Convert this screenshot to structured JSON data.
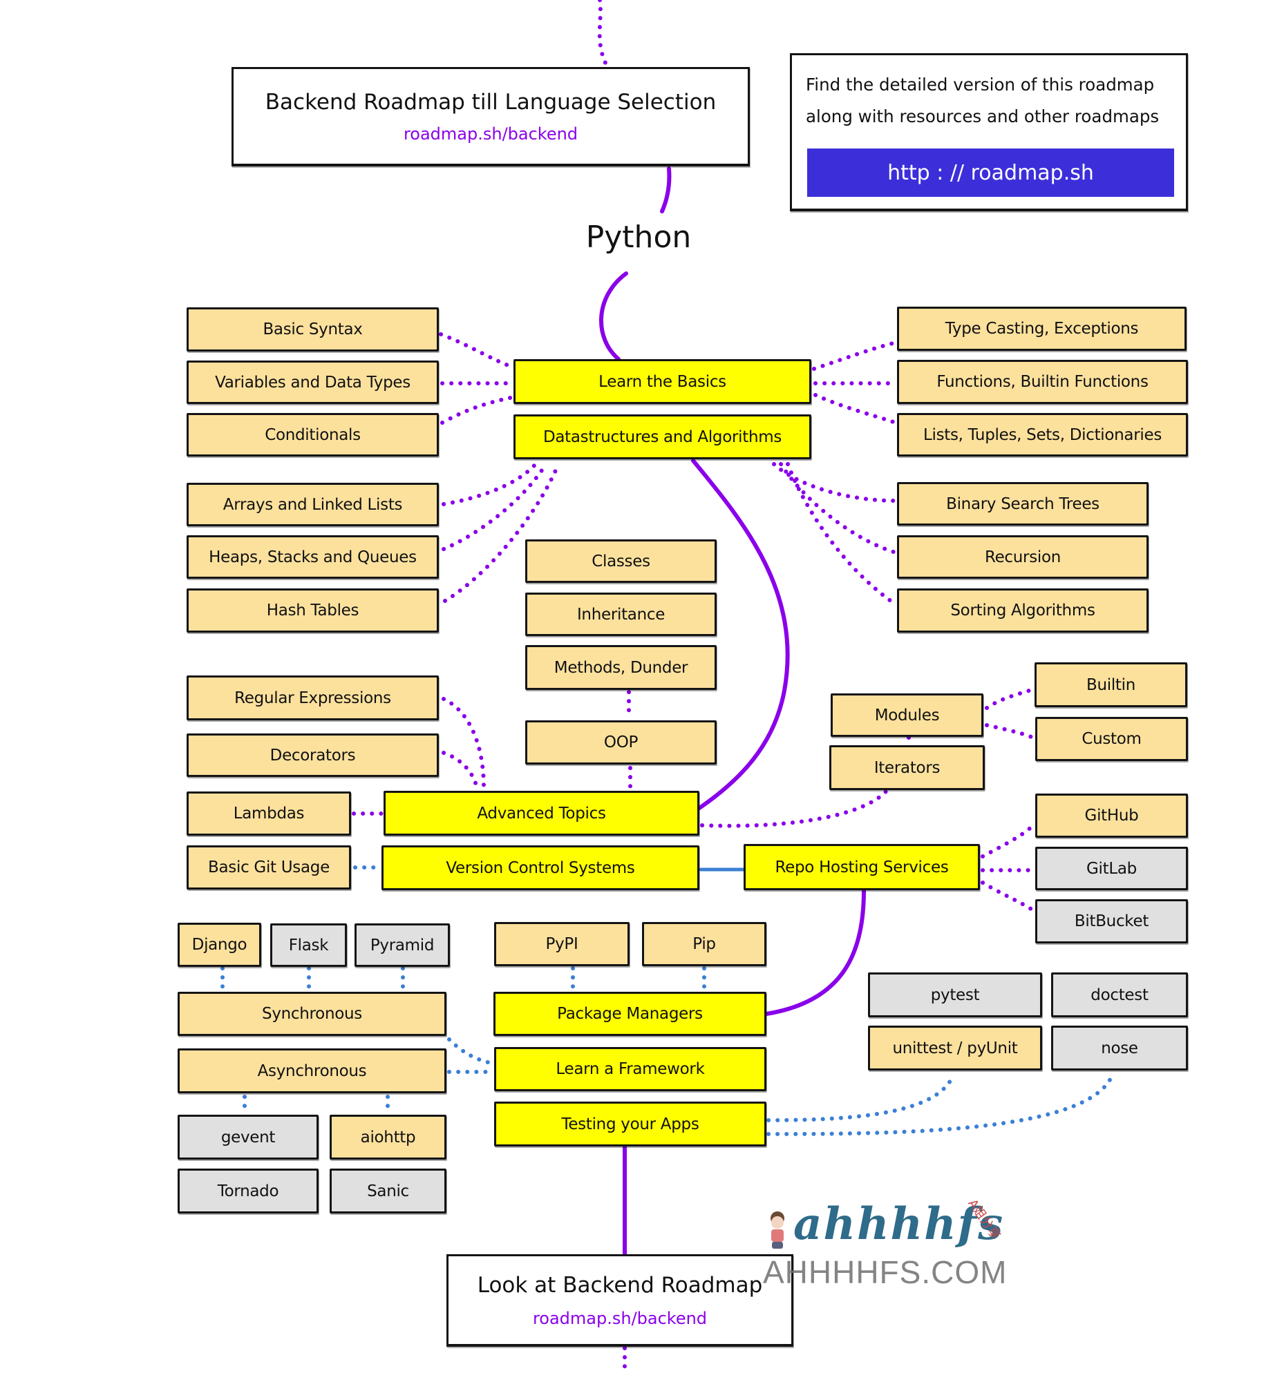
{
  "colors": {
    "main_node": "#ffff00",
    "sub_node": "#fce19d",
    "alt_node": "#e0e0e0",
    "purple_line": "#8a00ea",
    "blue_line": "#3b7fd6",
    "link_text": "#8a00ea",
    "info_button_bg": "#3c2fd9"
  },
  "header": {
    "title": "Backend Roadmap till Language Selection",
    "link": "roadmap.sh/backend"
  },
  "info_card": {
    "line1": "Find the detailed version of this roadmap",
    "line2": "along with resources and other roadmaps",
    "button_label": "http : // roadmap.sh"
  },
  "language": "Python",
  "nodes": {
    "learn_basics": "Learn the Basics",
    "basic_syntax": "Basic Syntax",
    "variables": "Variables and Data Types",
    "conditionals": "Conditionals",
    "type_casting": "Type Casting, Exceptions",
    "functions": "Functions, Builtin Functions",
    "lists": "Lists, Tuples, Sets, Dictionaries",
    "dsa": "Datastructures and Algorithms",
    "arrays": "Arrays and Linked Lists",
    "heaps": "Heaps, Stacks and Queues",
    "hash_tables": "Hash Tables",
    "bst": "Binary Search Trees",
    "recursion": "Recursion",
    "sorting": "Sorting Algorithms",
    "classes": "Classes",
    "inheritance": "Inheritance",
    "methods": "Methods, Dunder",
    "oop": "OOP",
    "regex": "Regular Expressions",
    "decorators": "Decorators",
    "lambdas": "Lambdas",
    "advanced": "Advanced Topics",
    "modules": "Modules",
    "iterators": "Iterators",
    "builtin": "Builtin",
    "custom": "Custom",
    "basic_git": "Basic Git Usage",
    "vcs": "Version Control Systems",
    "repo_hosting": "Repo Hosting Services",
    "github": "GitHub",
    "gitlab": "GitLab",
    "bitbucket": "BitBucket",
    "django": "Django",
    "flask": "Flask",
    "pyramid": "Pyramid",
    "synchronous": "Synchronous",
    "asynchronous": "Asynchronous",
    "gevent": "gevent",
    "aiohttp": "aiohttp",
    "tornado": "Tornado",
    "sanic": "Sanic",
    "pypi": "PyPI",
    "pip": "Pip",
    "package_managers": "Package Managers",
    "learn_framework": "Learn a Framework",
    "testing": "Testing your Apps",
    "pytest": "pytest",
    "doctest": "doctest",
    "unittest": "unittest / pyUnit",
    "nose": "nose"
  },
  "footer": {
    "title": "Look at Backend Roadmap",
    "link": "roadmap.sh/backend"
  },
  "watermark": {
    "logo": "ahhhhfs",
    "domain": "AHHHHFS.COM",
    "badge": "A姐分享"
  }
}
